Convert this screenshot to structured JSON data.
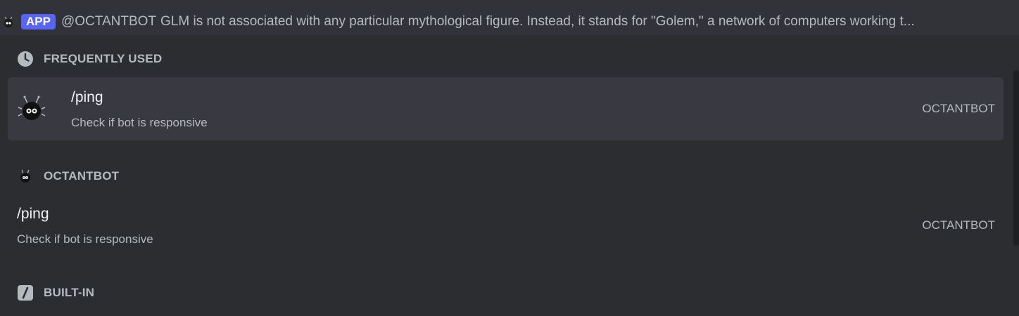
{
  "reply": {
    "badge": "APP",
    "author": "@OCTANTBOT",
    "text": "GLM is not associated with any particular mythological figure. Instead, it stands for \"Golem,\" a network of computers working t..."
  },
  "sections": {
    "frequently_used": {
      "label": "FREQUENTLY USED",
      "icon": "clock-icon"
    },
    "octantbot": {
      "label": "OCTANTBOT",
      "icon": "bot-avatar-icon"
    },
    "built_in": {
      "label": "BUILT-IN",
      "icon": "slash-command-icon"
    }
  },
  "commands": {
    "frequent_ping": {
      "name": "/ping",
      "description": "Check if bot is responsive",
      "source": "OCTANTBOT"
    },
    "bot_ping": {
      "name": "/ping",
      "description": "Check if bot is responsive",
      "source": "OCTANTBOT"
    }
  },
  "colors": {
    "accent": "#5865f2",
    "selected_row": "#393a41",
    "panel": "#2b2d31"
  }
}
